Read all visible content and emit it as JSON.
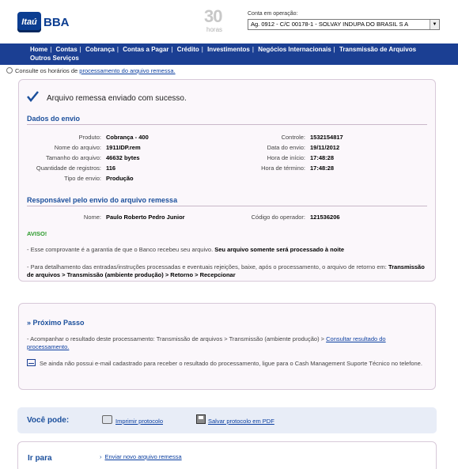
{
  "header": {
    "logo_itau": "Itaú",
    "logo_bba": "BBA",
    "hours_number": "30",
    "hours_label": "horas",
    "account_label": "Conta em operação:",
    "account_value": "Ag. 0912 - C/C 00178-1 - SOLVAY INDUPA DO BRASIL S A"
  },
  "nav": {
    "items": [
      "Home",
      "Contas",
      "Cobrança",
      "Contas a Pagar",
      "Crédito",
      "Investimentos",
      "Negócios Internacionais",
      "Transmissão de Arquivos",
      "Outros Serviços"
    ]
  },
  "notice": {
    "prefix": "Consulte os horários de ",
    "link": "processamento do arquivo remessa."
  },
  "success": {
    "message": "Arquivo remessa enviado com sucesso."
  },
  "dados": {
    "title": "Dados do envio",
    "left": [
      {
        "label": "Produto:",
        "value": "Cobrança - 400"
      },
      {
        "label": "Nome do arquivo:",
        "value": "1911IDP.rem"
      },
      {
        "label": "Tamanho do arquivo:",
        "value": "46632 bytes"
      },
      {
        "label": "Quantidade de registros:",
        "value": "116"
      },
      {
        "label": "Tipo de envio:",
        "value": "Produção"
      }
    ],
    "right": [
      {
        "label": "Controle:",
        "value": "1532154817"
      },
      {
        "label": "Data do envio:",
        "value": "19/11/2012"
      },
      {
        "label": "Hora de início:",
        "value": "17:48:28"
      },
      {
        "label": "Hora de término:",
        "value": "17:48:28"
      }
    ]
  },
  "responsavel": {
    "title": "Responsável pelo envio do arquivo remessa",
    "name_label": "Nome:",
    "name_value": "Paulo Roberto Pedro Junior",
    "operator_label": "Código do operador:",
    "operator_value": "121536206"
  },
  "aviso": {
    "label": "AVISO!",
    "line1_text": "- Esse comprovante é a garantia de que o Banco recebeu seu arquivo. ",
    "line1_bold": "Seu arquivo somente será processado à noite",
    "line2_text": "- Para detalhamento das entradas/instruções processadas e eventuais rejeições, baixe, após o processamento, o arquivo de retorno em: ",
    "line2_bold": "Transmissão de arquivos > Transmissão (ambiente produção) > Retorno > Recepcionar"
  },
  "proximo": {
    "title": "Próximo Passo",
    "chevrons": "»",
    "step_text": "- Acompanhar o resultado deste processamento: Transmissão de arquivos > Transmissão (ambiente produção) > ",
    "step_link": "Consultar resultado do processamento.",
    "email_text": "Se ainda não possui e-mail cadastrado para receber o resultado do processamento, ligue para o Cash Management Suporte Técnico no telefone."
  },
  "voce_pode": {
    "title": "Você pode:",
    "print_link": "Imprimir protocolo",
    "pdf_link": "Salvar protocolo em PDF"
  },
  "ir_para": {
    "title": "Ir para",
    "link": "Enviar novo arquivo remessa"
  }
}
